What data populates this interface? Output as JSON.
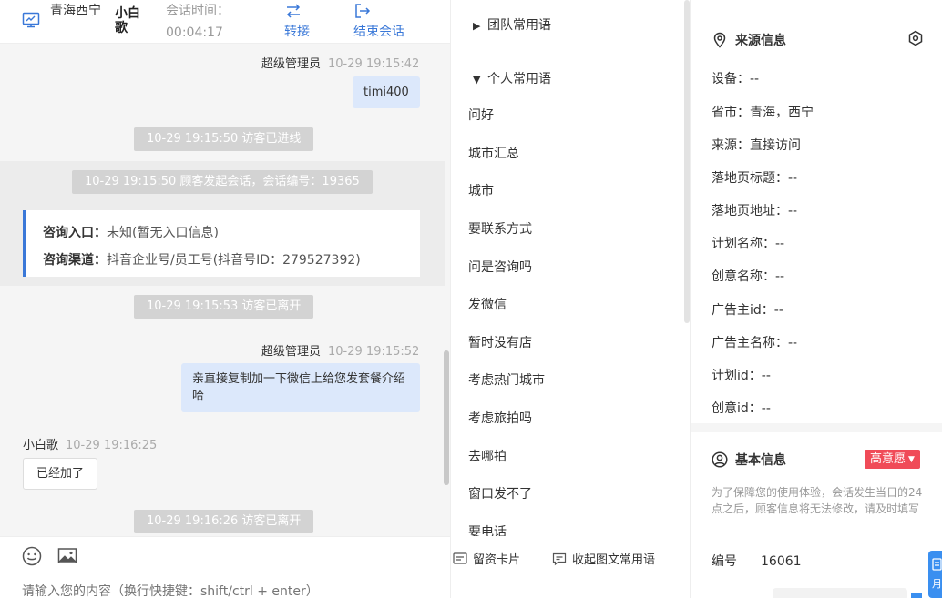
{
  "header": {
    "location": "青海西宁",
    "visitor_name": "小白歌",
    "time_label": "会话时间：",
    "time_value": "00:04:17",
    "transfer_label": "转接",
    "end_label": "结束会话"
  },
  "messages": {
    "m1_sender": "超级管理员",
    "m1_time": "10-29 19:15:42",
    "m1_text": "timi400",
    "sys1": "10-29 19:15:50 访客已进线",
    "sys2": "10-29 19:15:50 顾客发起会话，会话编号：19365",
    "entry_label": "咨询入口：",
    "entry_value": "未知(暂无入口信息)",
    "channel_label": "咨询渠道：",
    "channel_value": "抖音企业号/员工号(抖音号ID：279527392)",
    "sys3": "10-29 19:15:53 访客已离开",
    "m2_sender": "超级管理员",
    "m2_time": "10-29 19:15:52",
    "m2_text": "亲直接复制加一下微信上给您发套餐介绍哈",
    "m3_sender": "小白歌",
    "m3_time": "10-29 19:16:25",
    "m3_text": "已经加了",
    "sys4": "10-29 19:16:26 访客已离开"
  },
  "input": {
    "placeholder": "请输入您的内容（换行快捷键：shift/ctrl + enter）"
  },
  "quick_replies": {
    "team_group": "团队常用语",
    "personal_group": "个人常用语",
    "items": [
      "问好",
      "城市汇总",
      "城市",
      "要联系方式",
      "问是咨询吗",
      "发微信",
      "暂时没有店",
      "考虑热门城市",
      "考虑旅拍吗",
      "去哪拍",
      "窗口发不了",
      "要电话"
    ],
    "btn_card": "留资卡片",
    "btn_fav": "收起图文常用语"
  },
  "source_info": {
    "title": "来源信息",
    "rows": [
      "设备：--",
      "省市：青海，西宁",
      "来源：直接访问",
      "落地页标题：--",
      "落地页地址：--",
      "计划名称：--",
      "创意名称：--",
      "广告主id：--",
      "广告主名称：--",
      "计划id：--",
      "创意id：--"
    ]
  },
  "basic_info": {
    "title": "基本信息",
    "badge": "高意愿",
    "notice": "为了保障您的使用体验，会话发生当日的24点之后，顾客信息将无法修改，请及时填写",
    "id_label": "编号",
    "id_value": "16061",
    "side_tab_text": "月"
  },
  "colors": {
    "accent": "#3a78d8",
    "agent_bubble": "#dce8fb",
    "system_pill": "#d3d3d3",
    "badge": "#f04b58"
  }
}
